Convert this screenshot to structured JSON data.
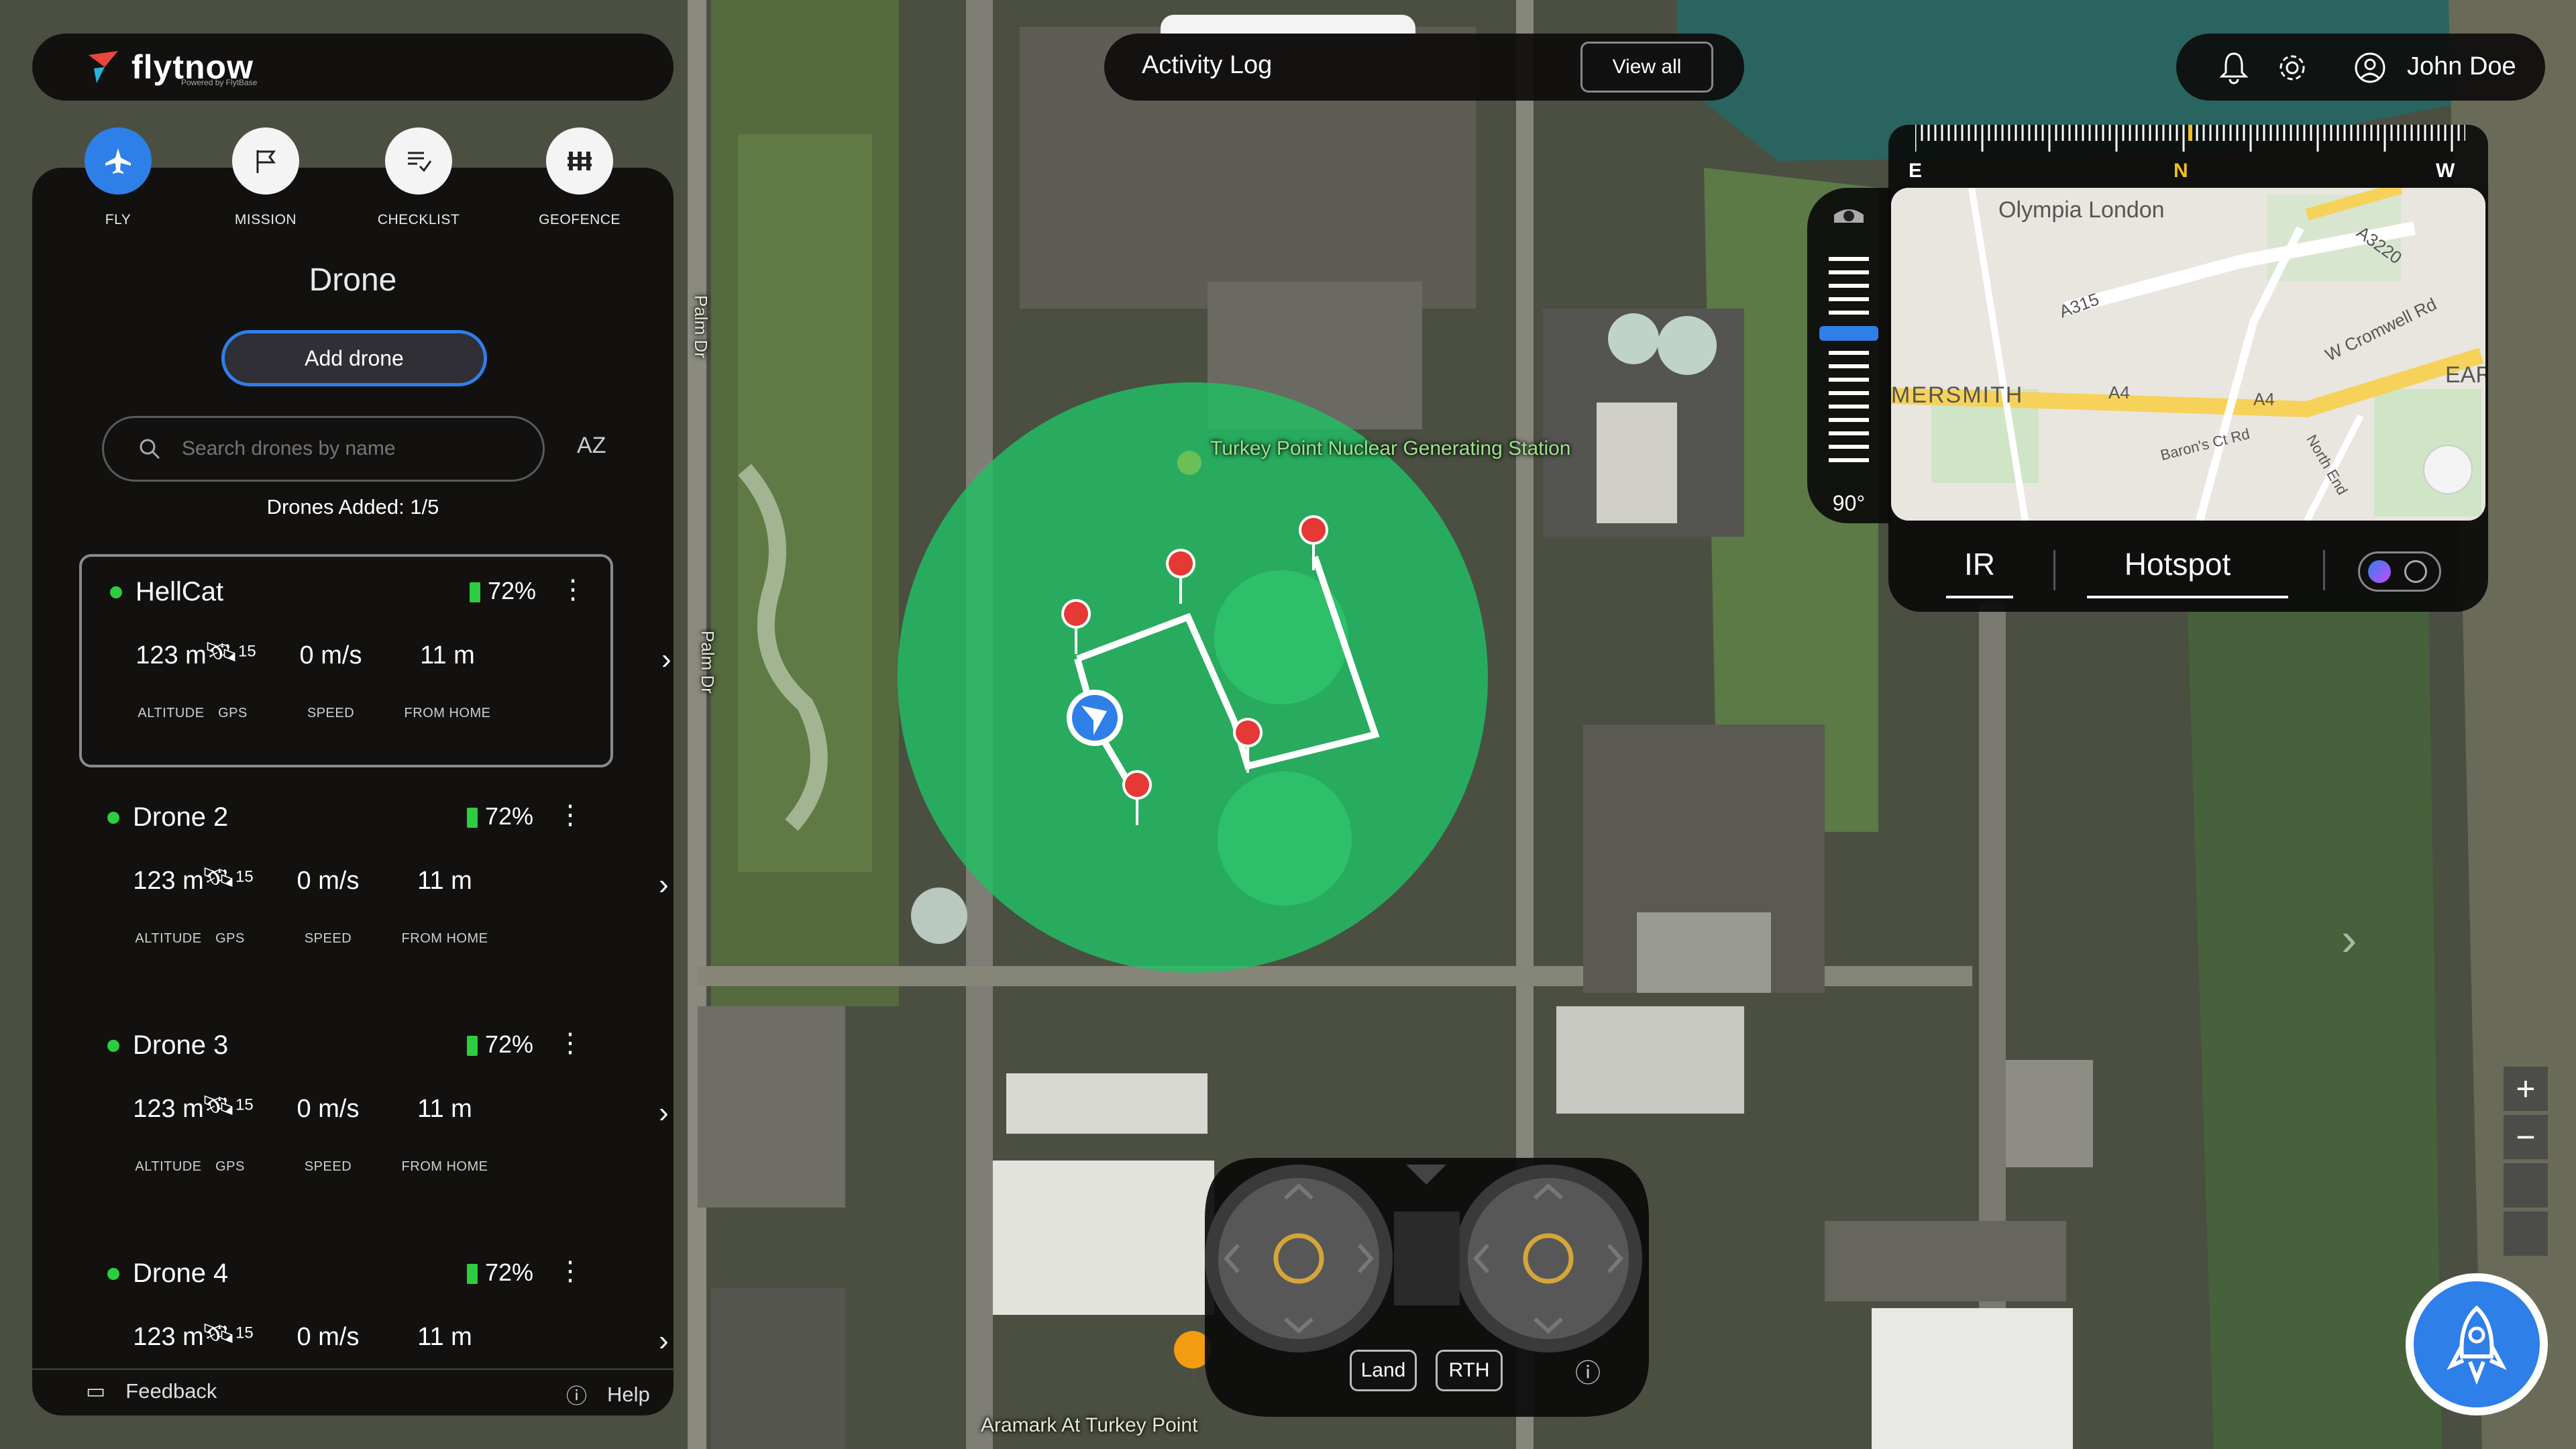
{
  "app": {
    "logo_text": "flytnow",
    "logo_sub": "Powered by FlytBase"
  },
  "colors": {
    "accent": "#2f7fe8",
    "geofence_fill": "#21c064",
    "status_green": "#2ecc40",
    "waypoint": "#e53935"
  },
  "modes": [
    {
      "label": "FLY",
      "icon": "plane-icon",
      "active": true
    },
    {
      "label": "MISSION",
      "icon": "flag-icon",
      "active": false
    },
    {
      "label": "CHECKLIST",
      "icon": "checklist-icon",
      "active": false
    },
    {
      "label": "GEOFENCE",
      "icon": "geofence-icon",
      "active": false
    }
  ],
  "panel": {
    "title": "Drone",
    "add_button": "Add drone",
    "search_placeholder": "Search drones by name",
    "sort_label": "AZ",
    "drones_added": "Drones Added: 1/5"
  },
  "stat_labels": {
    "altitude": "ALTITUDE",
    "gps": "GPS",
    "speed": "SPEED",
    "home": "FROM HOME"
  },
  "drones": [
    {
      "name": "HellCat",
      "battery": "72%",
      "altitude": "123 m",
      "gps_sats": "15",
      "speed": "0 m/s",
      "home": "11 m"
    },
    {
      "name": "Drone 2",
      "battery": "72%",
      "altitude": "123 m",
      "gps_sats": "15",
      "speed": "0 m/s",
      "home": "11 m"
    },
    {
      "name": "Drone 3",
      "battery": "72%",
      "altitude": "123 m",
      "gps_sats": "15",
      "speed": "0 m/s",
      "home": "11 m"
    },
    {
      "name": "Drone 4",
      "battery": "72%",
      "altitude": "123 m",
      "gps_sats": "15",
      "speed": "0 m/s",
      "home": "11 m"
    }
  ],
  "footer": {
    "feedback": "Feedback",
    "help": "Help"
  },
  "activity_log": {
    "title": "Activity Log",
    "view_all": "View all"
  },
  "user": {
    "name": "John Doe"
  },
  "compass": {
    "left": "E",
    "center": "N",
    "right": "W"
  },
  "camera": {
    "gimbal_angle": "90°"
  },
  "minimap": {
    "labels": [
      "Olympia London",
      "A3220",
      "A315",
      "MERSMITH",
      "A4",
      "A4",
      "W Cromwell Rd",
      "Baron's Ct Rd",
      "North End",
      "EAR"
    ],
    "tab_ir": "IR",
    "tab_hotspot": "Hotspot"
  },
  "map": {
    "poi_1": "Turkey Point Nuclear Generating Station",
    "poi_2": "Aramark At Turkey Point",
    "road_1": "Palm Dr",
    "road_2": "Palm Dr"
  },
  "controller": {
    "land": "Land",
    "rth": "RTH"
  },
  "zoom": {
    "in": "+",
    "out": "−"
  }
}
